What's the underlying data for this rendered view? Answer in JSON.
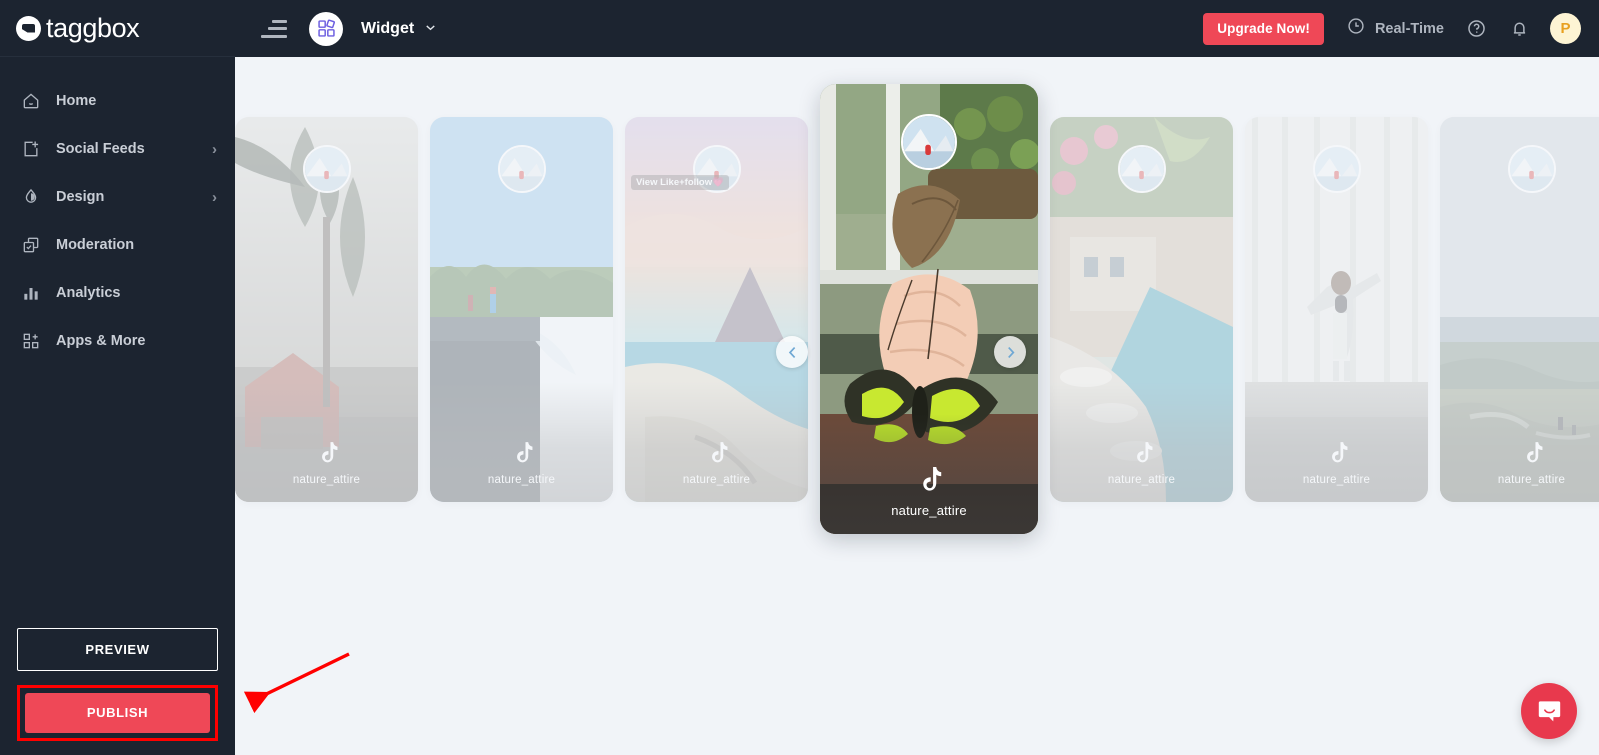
{
  "brand": {
    "name": "taggbox",
    "logo_icon": "taggbox-logo-icon"
  },
  "sidebar": {
    "items": [
      {
        "label": "Home",
        "icon": "home-icon",
        "chevron": ""
      },
      {
        "label": "Social Feeds",
        "icon": "add-feed-icon",
        "chevron": "›"
      },
      {
        "label": "Design",
        "icon": "droplet-icon",
        "chevron": "›"
      },
      {
        "label": "Moderation",
        "icon": "moderation-icon",
        "chevron": ""
      },
      {
        "label": "Analytics",
        "icon": "analytics-bar-icon",
        "chevron": ""
      },
      {
        "label": "Apps & More",
        "icon": "apps-grid-icon",
        "chevron": ""
      }
    ],
    "preview_label": "PREVIEW",
    "publish_label": "PUBLISH",
    "highlight_color": "#ff0000",
    "publish_color": "#ef4857"
  },
  "topbar": {
    "menu_icon": "hamburger-menu-icon",
    "widget_icon": "widget-blocks-icon",
    "title": "Widget",
    "caret": "⌄",
    "upgrade_label": "Upgrade Now!",
    "upgrade_color": "#ef4857",
    "realtime_label": "Real-Time",
    "realtime_icon": "clock-icon",
    "help_icon": "help-circle-icon",
    "bell_icon": "notification-bell-icon",
    "avatar_initial": "P",
    "avatar_bg": "#fdf4d4",
    "avatar_fg": "#e8a020"
  },
  "carousel": {
    "prev_label": "‹",
    "next_label": "›",
    "network_icon": "tiktok-icon",
    "cards": [
      {
        "username": "nature_attire",
        "active": false,
        "overlay": "",
        "alt": "cabin-among-pine-trees"
      },
      {
        "username": "nature_attire",
        "active": false,
        "overlay": "",
        "alt": "waterfall-with-hikers"
      },
      {
        "username": "nature_attire",
        "active": false,
        "overlay": "View\nLike+follow💗",
        "alt": "sunset-coastal-mountain"
      },
      {
        "username": "nature_attire",
        "active": true,
        "overlay": "",
        "alt": "butterfly-on-hand"
      },
      {
        "username": "nature_attire",
        "active": false,
        "overlay": "",
        "alt": "cliffside-resort-pool"
      },
      {
        "username": "nature_attire",
        "active": false,
        "overlay": "",
        "alt": "woman-by-waterfall"
      },
      {
        "username": "nature_attire",
        "active": false,
        "overlay": "",
        "alt": "mountain-plateau-view"
      }
    ]
  },
  "chat": {
    "icon": "chat-bubble-icon",
    "color": "#e8394d"
  },
  "annotation": {
    "arrow_color": "#ff0000",
    "target": "publish-button"
  }
}
